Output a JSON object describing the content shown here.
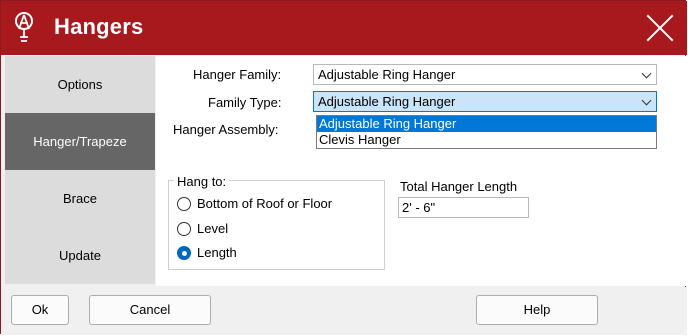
{
  "window": {
    "title": "Hangers",
    "logo": "app-logo-icon",
    "close": "close-icon"
  },
  "sidebar": {
    "items": [
      {
        "label": "Options",
        "active": false
      },
      {
        "label": "Hanger/Trapeze",
        "active": true
      },
      {
        "label": "Brace",
        "active": false
      },
      {
        "label": "Update",
        "active": false
      }
    ]
  },
  "form": {
    "hanger_family": {
      "label": "Hanger Family:",
      "value": "Adjustable Ring Hanger"
    },
    "family_type": {
      "label": "Family Type:",
      "value": "Adjustable Ring Hanger",
      "options": [
        "Adjustable Ring Hanger",
        "Clevis Hanger"
      ]
    },
    "hanger_assembly": {
      "label": "Hanger Assembly:"
    },
    "hang_to": {
      "title": "Hang to:",
      "options": [
        {
          "label": "Bottom of Roof or Floor",
          "checked": false
        },
        {
          "label": "Level",
          "checked": false
        },
        {
          "label": "Length",
          "checked": true
        }
      ]
    },
    "total_length": {
      "label": "Total Hanger Length",
      "value": "2' - 6\""
    }
  },
  "footer": {
    "ok": "Ok",
    "cancel": "Cancel",
    "help": "Help"
  },
  "colors": {
    "titlebar": "#a8191e",
    "selection": "#0078d7",
    "active_tab": "#666666"
  }
}
